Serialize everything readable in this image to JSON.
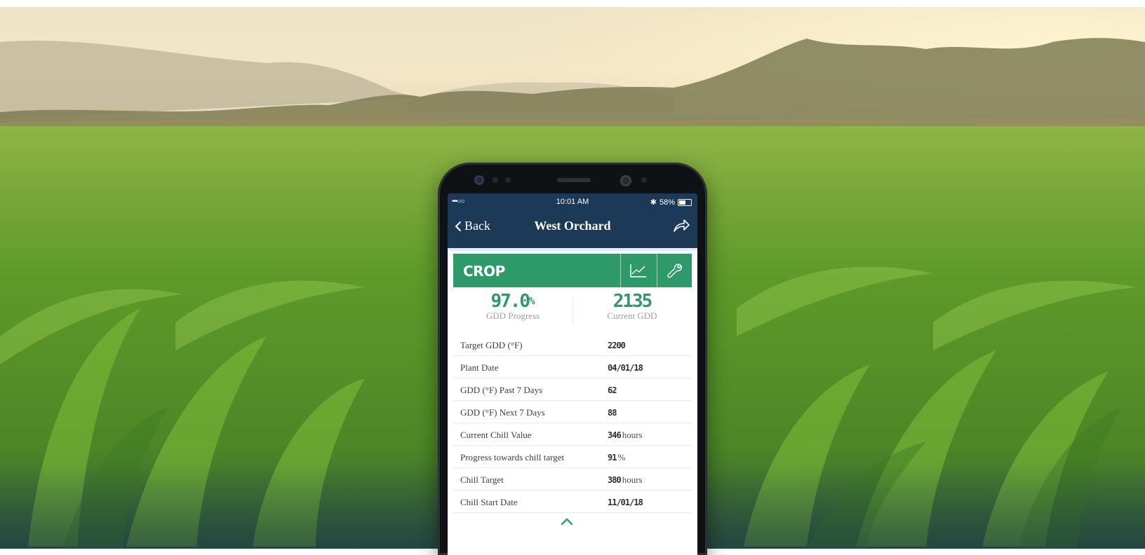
{
  "colors": {
    "accent": "#2e9a6a",
    "nav_bg": "#1c3a57",
    "text_dark": "#2b2f33",
    "text_muted": "#9aa0a5"
  },
  "status_bar": {
    "signal": "•••○○",
    "time": "10:01 AM",
    "bluetooth": "✱",
    "battery": "58%",
    "battery_level": 0.58
  },
  "nav": {
    "back_label": "Back",
    "title": "West Orchard",
    "share_icon": "share-icon"
  },
  "card": {
    "title": "CROP",
    "chart_icon": "chart-icon",
    "wrench_icon": "wrench-icon"
  },
  "stats": {
    "progress_value": "97.0",
    "progress_unit": "%",
    "progress_label": "GDD Progress",
    "current_value": "2135",
    "current_label": "Current GDD"
  },
  "rows": [
    {
      "label": "Target GDD (°F)",
      "value": "2200",
      "unit": ""
    },
    {
      "label": "Plant Date",
      "value": "04/01/18",
      "unit": ""
    },
    {
      "label": "GDD (°F) Past 7 Days",
      "value": "62",
      "unit": ""
    },
    {
      "label": "GDD (°F) Next 7 Days",
      "value": "88",
      "unit": ""
    },
    {
      "label": "Current Chill Value",
      "value": "346",
      "unit": "hours"
    },
    {
      "label": "Progress towards chill target",
      "value": "91",
      "unit": "%"
    },
    {
      "label": "Chill Target",
      "value": "380",
      "unit": "hours"
    },
    {
      "label": "Chill Start Date",
      "value": "11/01/18",
      "unit": ""
    }
  ],
  "expand_icon": "chevron-up-icon"
}
